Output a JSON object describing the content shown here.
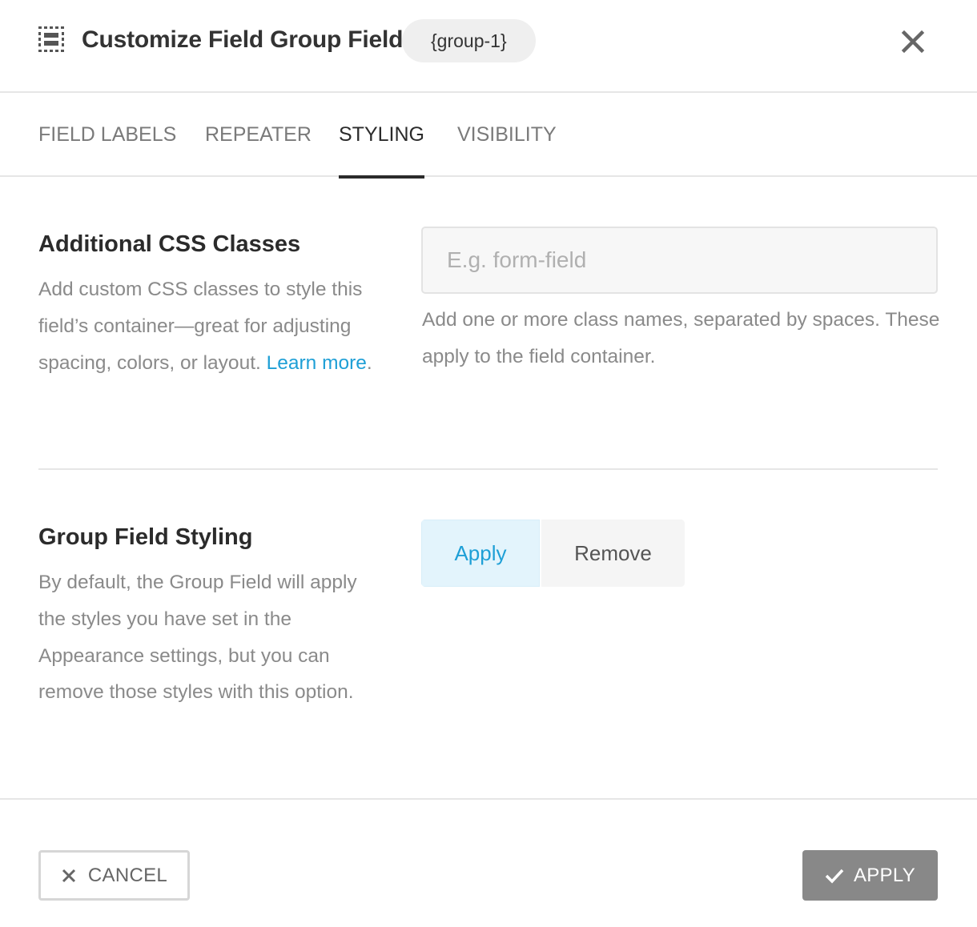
{
  "header": {
    "icon": "field-group-icon",
    "title": "Customize Field Group Field",
    "merge_tag": "{group-1}",
    "close_icon": "close-icon"
  },
  "tabs": [
    {
      "label": "FIELD LABELS",
      "active": false
    },
    {
      "label": "REPEATER",
      "active": false
    },
    {
      "label": "STYLING",
      "active": true
    },
    {
      "label": "VISIBILITY",
      "active": false
    }
  ],
  "css_classes": {
    "title": "Additional CSS Classes",
    "description": "Add custom CSS classes to style this field’s container—great for adjusting spacing, colors, or layout.",
    "learn_more": "Learn more",
    "learn_more_suffix": ".",
    "input_value": "",
    "input_placeholder": "E.g. form-field",
    "help": "Add one or more class names, separated by spaces. These apply to the field container."
  },
  "group_styling": {
    "title": "Group Field Styling",
    "description": "By default, the Group Field will apply the styles you have set in the Appearance settings, but you can remove those styles with this option.",
    "options": [
      {
        "label": "Apply",
        "selected": true
      },
      {
        "label": "Remove",
        "selected": false
      }
    ]
  },
  "footer": {
    "cancel_label": "CANCEL",
    "cancel_icon": "x-icon",
    "apply_label": "APPLY",
    "apply_icon": "checkmark-icon"
  },
  "colors": {
    "accent": "#1e9fd6",
    "selected_bg": "#e3f4fc",
    "apply_button_bg": "#888888"
  }
}
